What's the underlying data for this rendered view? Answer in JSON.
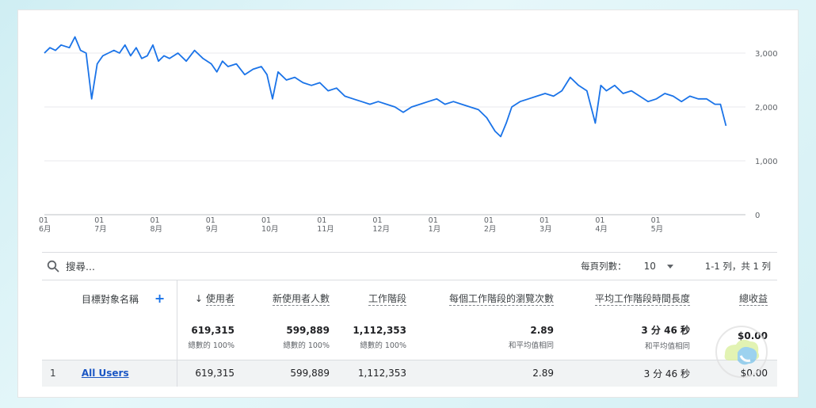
{
  "chart_data": {
    "type": "line",
    "x_labels": [
      {
        "day": "01",
        "month": "6月"
      },
      {
        "day": "01",
        "month": "7月"
      },
      {
        "day": "01",
        "month": "8月"
      },
      {
        "day": "01",
        "month": "9月"
      },
      {
        "day": "01",
        "month": "10月"
      },
      {
        "day": "01",
        "month": "11月"
      },
      {
        "day": "01",
        "month": "12月"
      },
      {
        "day": "01",
        "month": "1月"
      },
      {
        "day": "01",
        "month": "2月"
      },
      {
        "day": "01",
        "month": "3月"
      },
      {
        "day": "01",
        "month": "4月"
      },
      {
        "day": "01",
        "month": "5月"
      }
    ],
    "y_ticks": [
      "3,000",
      "2,000",
      "1,000",
      "0"
    ],
    "ylim": [
      0,
      3500
    ],
    "grid": true,
    "series_color": "#1a73e8",
    "x_range": [
      0,
      12.6
    ],
    "series": [
      {
        "x": [
          0.0,
          0.1,
          0.2,
          0.3,
          0.45,
          0.55,
          0.65,
          0.75,
          0.85,
          0.95,
          1.05,
          1.15,
          1.25,
          1.35,
          1.45,
          1.55,
          1.65,
          1.75,
          1.85,
          1.95,
          2.05,
          2.15,
          2.25,
          2.4,
          2.55,
          2.7,
          2.85,
          3.0,
          3.1,
          3.2,
          3.3,
          3.45,
          3.6,
          3.75,
          3.9,
          4.0,
          4.1,
          4.2,
          4.35,
          4.5,
          4.65,
          4.8,
          4.95,
          5.1,
          5.25,
          5.4,
          5.55,
          5.7,
          5.85,
          6.0,
          6.15,
          6.3,
          6.45,
          6.6,
          6.75,
          6.9,
          7.05,
          7.2,
          7.35,
          7.5,
          7.65,
          7.8,
          7.95,
          8.1,
          8.2,
          8.3,
          8.4,
          8.55,
          8.7,
          8.85,
          9.0,
          9.15,
          9.3,
          9.45,
          9.6,
          9.75,
          9.9,
          10.0,
          10.1,
          10.25,
          10.4,
          10.55,
          10.7,
          10.85,
          11.0,
          11.15,
          11.3,
          11.45,
          11.6,
          11.75,
          11.9,
          12.05,
          12.15,
          12.25
        ],
        "y": [
          3000,
          3100,
          3050,
          3150,
          3100,
          3300,
          3050,
          3000,
          2150,
          2800,
          2950,
          3000,
          3050,
          3000,
          3150,
          2950,
          3100,
          2900,
          2950,
          3150,
          2850,
          2950,
          2900,
          3000,
          2850,
          3050,
          2900,
          2800,
          2650,
          2850,
          2750,
          2800,
          2600,
          2700,
          2750,
          2600,
          2150,
          2650,
          2500,
          2550,
          2450,
          2400,
          2450,
          2300,
          2350,
          2200,
          2150,
          2100,
          2050,
          2100,
          2050,
          2000,
          1900,
          2000,
          2050,
          2100,
          2150,
          2050,
          2100,
          2050,
          2000,
          1950,
          1800,
          1550,
          1450,
          1700,
          2000,
          2100,
          2150,
          2200,
          2250,
          2200,
          2300,
          2550,
          2400,
          2300,
          1700,
          2400,
          2300,
          2400,
          2250,
          2300,
          2200,
          2100,
          2150,
          2250,
          2200,
          2100,
          2200,
          2150,
          2150,
          2050,
          2050,
          1650
        ]
      }
    ]
  },
  "search": {
    "placeholder": "搜尋..."
  },
  "pagination": {
    "rows_label": "每頁列數：",
    "rows_value": "10",
    "range": "1-1 列，共 1 列"
  },
  "table": {
    "dimension_header": "目標對象名稱",
    "columns": [
      "使用者",
      "新使用者人數",
      "工作階段",
      "每個工作階段的瀏覽次數",
      "平均工作階段時間長度",
      "總收益"
    ],
    "totals": [
      {
        "value": "619,315",
        "sub": "總數的 100%"
      },
      {
        "value": "599,889",
        "sub": "總數的 100%"
      },
      {
        "value": "1,112,353",
        "sub": "總數的 100%"
      },
      {
        "value": "2.89",
        "sub": "和平均值相同"
      },
      {
        "value": "3 分 46 秒",
        "sub": "和平均值相同"
      },
      {
        "value": "$0.00",
        "sub": ""
      }
    ],
    "rows": [
      {
        "index": "1",
        "name": "All Users",
        "values": [
          "619,315",
          "599,889",
          "1,112,353",
          "2.89",
          "3 分 46 秒",
          "$0.00"
        ]
      }
    ]
  }
}
